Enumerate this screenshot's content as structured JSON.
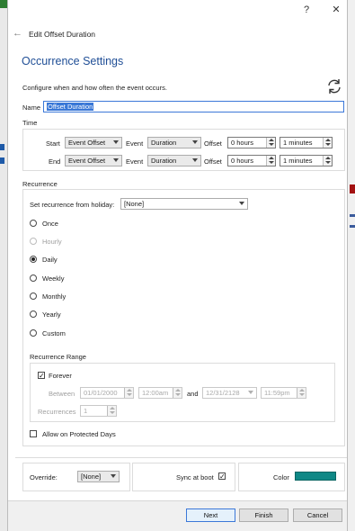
{
  "window": {
    "help_icon_label": "?",
    "close_icon_label": "✕"
  },
  "header": {
    "back_arrow": "←",
    "dialog_title": "Edit Offset Duration"
  },
  "page": {
    "heading": "Occurrence Settings",
    "description": "Configure when and how often the event occurs."
  },
  "name": {
    "label": "Name",
    "value": "Offset Duration"
  },
  "time": {
    "section_label": "Time",
    "rows": [
      {
        "label": "Start",
        "event_offset": "Event Offset",
        "event_label": "Event",
        "event_value": "Duration",
        "offset_label": "Offset",
        "hours": "0 hours",
        "minutes": "1 minutes"
      },
      {
        "label": "End",
        "event_offset": "Event Offset",
        "event_label": "Event",
        "event_value": "Duration",
        "offset_label": "Offset",
        "hours": "0 hours",
        "minutes": "1 minutes"
      }
    ]
  },
  "recurrence": {
    "section_label": "Recurrence",
    "holiday_label": "Set recurrence from holiday:",
    "holiday_value": "[None]",
    "options": [
      "Once",
      "Hourly",
      "Daily",
      "Weekly",
      "Monthly",
      "Yearly",
      "Custom"
    ],
    "selected": "Daily",
    "disabled": [
      "Hourly"
    ]
  },
  "range": {
    "section_label": "Recurrence Range",
    "forever_label": "Forever",
    "forever_checked": true,
    "between_label": "Between",
    "start_date": "01/01/2000",
    "start_time": "12:00am",
    "and_label": "and",
    "end_date": "12/31/2128",
    "end_time": "11:59pm",
    "recurrences_label": "Recurrences",
    "recurrences_value": "1"
  },
  "protected": {
    "label": "Allow on Protected Days",
    "checked": false
  },
  "bottom": {
    "override_label": "Override:",
    "override_value": "[None]",
    "sync_label": "Sync at boot",
    "sync_checked": true,
    "color_label": "Color",
    "color_value": "#0f8886"
  },
  "footer": {
    "next": "Next",
    "finish": "Finish",
    "cancel": "Cancel"
  }
}
